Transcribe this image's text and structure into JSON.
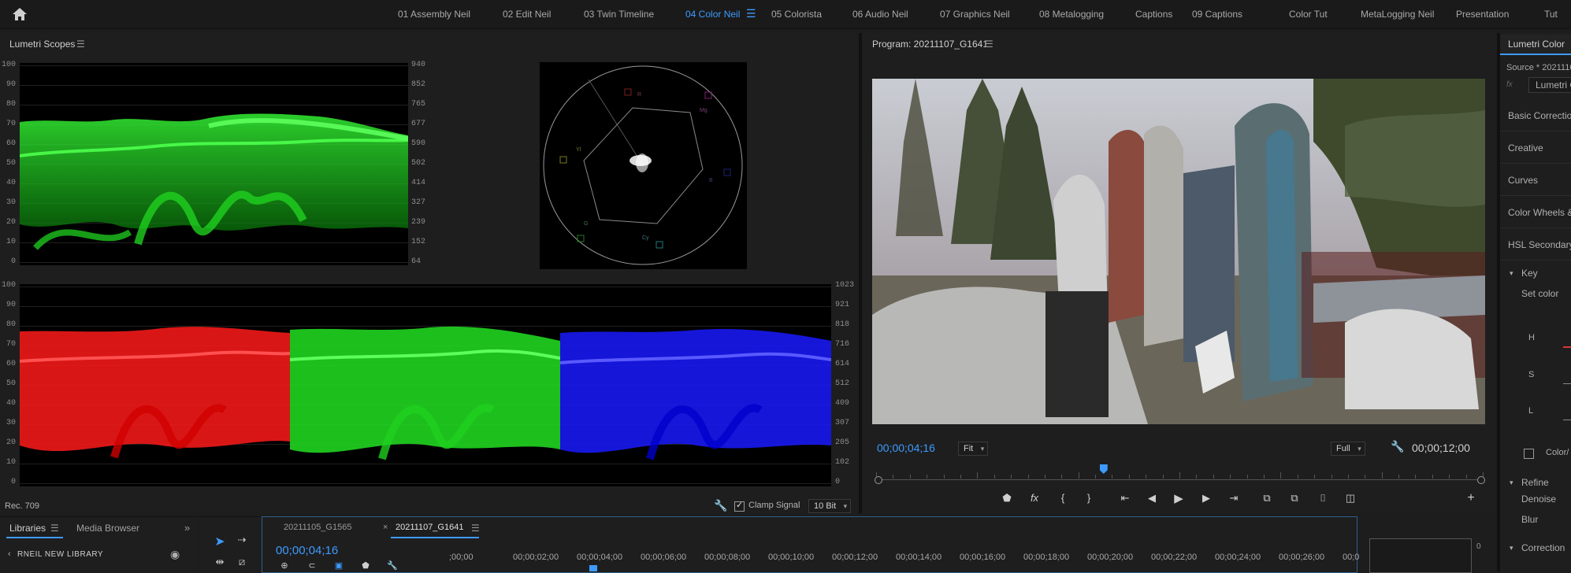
{
  "workspace_tabs": [
    {
      "label": "01 Assembly Neil",
      "active": false
    },
    {
      "label": "02 Edit Neil",
      "active": false
    },
    {
      "label": "03 Twin Timeline",
      "active": false
    },
    {
      "label": "04 Color Neil",
      "active": true
    },
    {
      "label": "05 Colorista",
      "active": false
    },
    {
      "label": "06 Audio Neil",
      "active": false
    },
    {
      "label": "07 Graphics Neil",
      "active": false
    },
    {
      "label": "08 Metalogging",
      "active": false
    },
    {
      "label": "Captions",
      "active": false
    },
    {
      "label": "09 Captions",
      "active": false
    },
    {
      "label": "Color Tut",
      "active": false
    },
    {
      "label": "MetaLogging Neil",
      "active": false
    },
    {
      "label": "Presentation",
      "active": false
    },
    {
      "label": "Tut",
      "active": false
    }
  ],
  "scopes": {
    "title": "Lumetri Scopes",
    "left_ticks": [
      "100",
      "90",
      "80",
      "70",
      "60",
      "50",
      "40",
      "30",
      "20",
      "10",
      "0"
    ],
    "wave_right_ticks": [
      "940",
      "852",
      "765",
      "677",
      "590",
      "502",
      "414",
      "327",
      "239",
      "152",
      "64"
    ],
    "parade_right_ticks": [
      "1023",
      "921",
      "818",
      "716",
      "614",
      "512",
      "409",
      "307",
      "205",
      "102",
      "0"
    ],
    "vector_labels": {
      "r": "R",
      "mg": "Mg",
      "b": "B",
      "cy": "Cy",
      "g": "G",
      "yl": "Yl"
    },
    "footer": {
      "colorspace": "Rec. 709",
      "clamp_label": "Clamp Signal",
      "clamp_checked": true,
      "bitdepth": "10 Bit"
    }
  },
  "program": {
    "title": "Program: 20211107_G1641",
    "timecode": "00;00;04;16",
    "fit": "Fit",
    "quality": "Full",
    "duration": "00;00;12;00",
    "playhead_fraction": 0.375
  },
  "lumetri_color": {
    "tab": "Lumetri Color",
    "source": "Source * 2021110",
    "effect": "Lumetri C",
    "sections": [
      "Basic Correction",
      "Creative",
      "Curves",
      "Color Wheels &",
      "HSL Secondary"
    ],
    "key_label": "Key",
    "set_color": "Set color",
    "hsl": [
      "H",
      "S",
      "L"
    ],
    "color_gray": "Color/",
    "refine_label": "Refine",
    "refine_items": [
      "Denoise",
      "Blur"
    ],
    "correction_label": "Correction"
  },
  "libraries": {
    "tab_libraries": "Libraries",
    "tab_media": "Media Browser",
    "library_name": "RNEIL NEW LIBRARY"
  },
  "timeline": {
    "tab_inactive": "20211105_G1565",
    "tab_active": "20211107_G1641",
    "timecode": "00;00;04;16",
    "ruler": [
      ";00;00",
      "00;00;02;00",
      "00;00;04;00",
      "00;00;06;00",
      "00;00;08;00",
      "00;00;10;00",
      "00;00;12;00",
      "00;00;14;00",
      "00;00;16;00",
      "00;00;18;00",
      "00;00;20;00",
      "00;00;22;00",
      "00;00;24;00",
      "00;00;26;00",
      "00;0"
    ],
    "meter_label": "0"
  },
  "colors": {
    "accent": "#3d9bff",
    "wave_green": "#22e022",
    "parade_red": "#ff1a1a",
    "parade_blue": "#1a1aff"
  }
}
